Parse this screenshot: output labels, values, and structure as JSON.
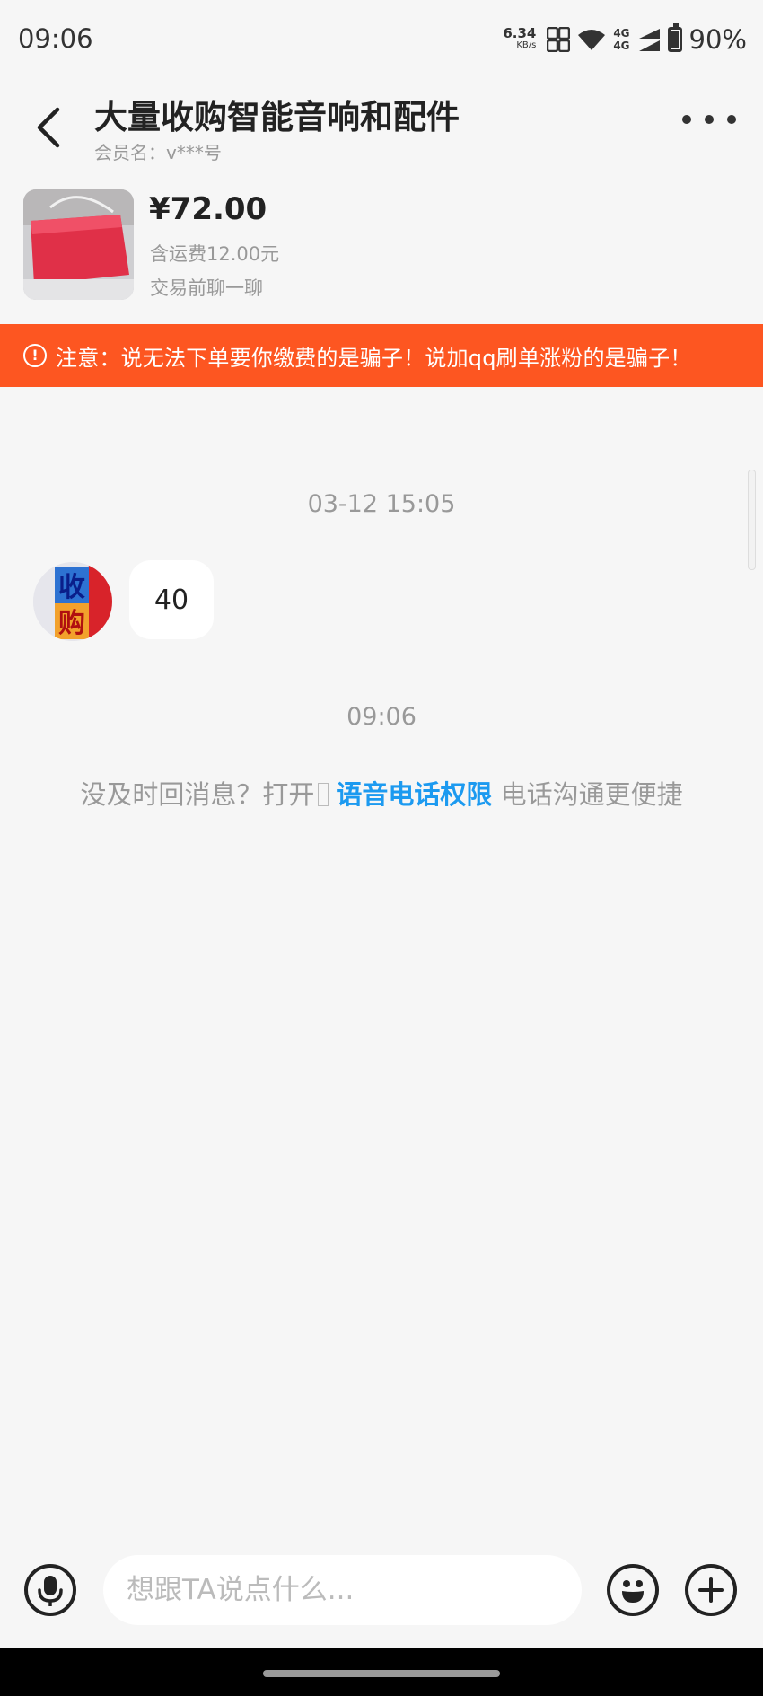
{
  "status_bar": {
    "time": "09:06",
    "net_speed_value": "6.34",
    "net_speed_unit": "KB/s",
    "network_1": "4G",
    "network_2": "4G",
    "battery": "90%"
  },
  "header": {
    "title": "大量收购智能音响和配件",
    "member": "会员名：v***号"
  },
  "product": {
    "price": "¥72.00",
    "shipping": "含运费12.00元",
    "note": "交易前聊一聊"
  },
  "warning": {
    "text": "注意：说无法下单要你缴费的是骗子！说加qq刷单涨粉的是骗子！"
  },
  "chat": {
    "timestamp_1": "03-12 15:05",
    "avatar_text_1": "收",
    "avatar_text_2": "购",
    "message_1": "40",
    "timestamp_2": "09:06",
    "tip_prefix": "没及时回消息？打开",
    "tip_link": "语音电话权限",
    "tip_suffix": "电话沟通更便捷"
  },
  "input": {
    "placeholder": "想跟TA说点什么..."
  },
  "colors": {
    "warning_bg": "#fd5621",
    "link": "#1c9af0",
    "background": "#f6f6f6"
  }
}
